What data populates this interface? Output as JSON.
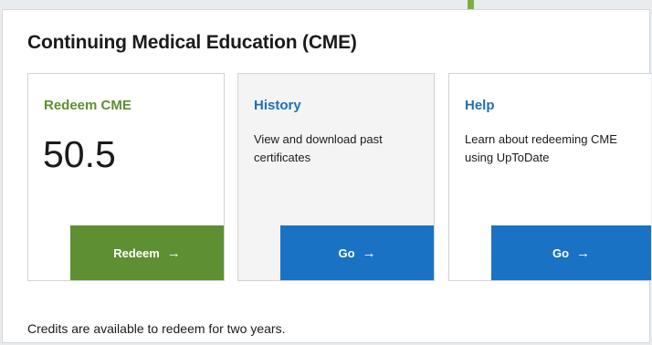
{
  "header": {
    "title": "Continuing Medical Education (CME)"
  },
  "cards": {
    "redeem": {
      "title": "Redeem CME",
      "credits": "50.5",
      "button_label": "Redeem",
      "button_icon": "arrow-right-icon"
    },
    "history": {
      "title": "History",
      "description": "View and download past certificates",
      "button_label": "Go",
      "button_icon": "arrow-right-icon"
    },
    "help": {
      "title": "Help",
      "description": "Learn about redeeming CME using UpToDate",
      "button_label": "Go",
      "button_icon": "arrow-right-icon"
    }
  },
  "footer": {
    "note": "Credits are available to redeem for two years."
  },
  "colors": {
    "redeem_green": "#5e8f32",
    "link_blue": "#1f6fb8",
    "button_blue": "#1a72c4",
    "history_bg": "#f4f4f5"
  }
}
